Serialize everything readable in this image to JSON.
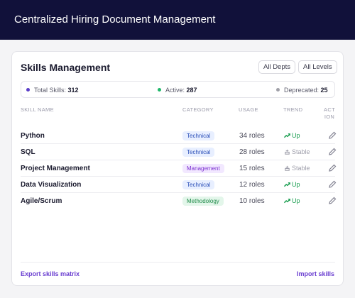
{
  "header": {
    "title": "Centralized Hiring Document Management"
  },
  "card": {
    "title": "Skills Management",
    "filters": [
      "All Depts",
      "All Levels"
    ]
  },
  "stats": {
    "total_label": "Total Skills:",
    "total_value": "312",
    "total_color": "#5b3ec8",
    "active_label": "Active:",
    "active_value": "287",
    "active_color": "#1fb86a",
    "deprecated_label": "Deprecated:",
    "deprecated_value": "25",
    "deprecated_color": "#a0a0a8"
  },
  "table": {
    "headers": {
      "name": "SKILL NAME",
      "category": "CATEGORY",
      "usage": "USAGE",
      "trend": "TREND",
      "action": "ACT ION"
    },
    "rows": [
      {
        "name": "Python",
        "category": "Technical",
        "usage": "34 roles",
        "trend": "Up"
      },
      {
        "name": "SQL",
        "category": "Technical",
        "usage": "28 roles",
        "trend": "Stable"
      },
      {
        "name": "Project Management",
        "category": "Management",
        "usage": "15 roles",
        "trend": "Stable"
      },
      {
        "name": "Data Visualization",
        "category": "Technical",
        "usage": "12 roles",
        "trend": "Up"
      },
      {
        "name": "Agile/Scrum",
        "category": "Methodology",
        "usage": "10 roles",
        "trend": "Up"
      }
    ]
  },
  "footer": {
    "export_label": "Export skills matrix",
    "import_label": "Import skills"
  }
}
